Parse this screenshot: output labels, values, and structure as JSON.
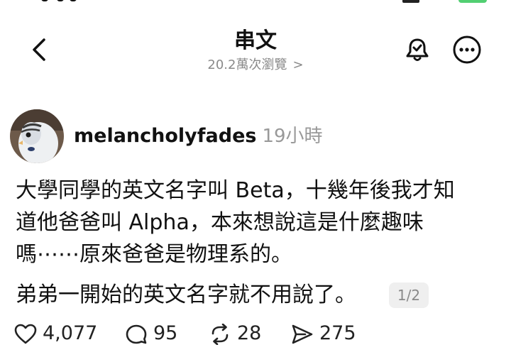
{
  "header": {
    "title": "串文",
    "views": "20.2萬次瀏覽",
    "views_chevron": ">"
  },
  "post": {
    "author": "melancholyfades",
    "time": "19小時",
    "text_lines": [
      "大學同學的英文名字叫 Beta，十幾年後我才知",
      "道他爸爸叫 Alpha，本來想說這是什麼趣味",
      "嗎⋯⋯原來爸爸是物理系的。"
    ],
    "continuation": "弟弟一開始的英文名字就不用說了。",
    "page_indicator": "1/2"
  },
  "actions": {
    "likes": "4,077",
    "comments": "95",
    "reposts": "28",
    "shares": "275"
  },
  "icons": {
    "back": "chevron-left-icon",
    "bell": "bell-icon",
    "more": "more-horizontal-icon",
    "like": "heart-icon",
    "comment": "comment-icon",
    "repost": "repost-icon",
    "share": "send-icon"
  },
  "colors": {
    "text": "#111111",
    "muted": "#8a8a8a",
    "badge_bg": "#efefef",
    "battery": "#34c759"
  }
}
